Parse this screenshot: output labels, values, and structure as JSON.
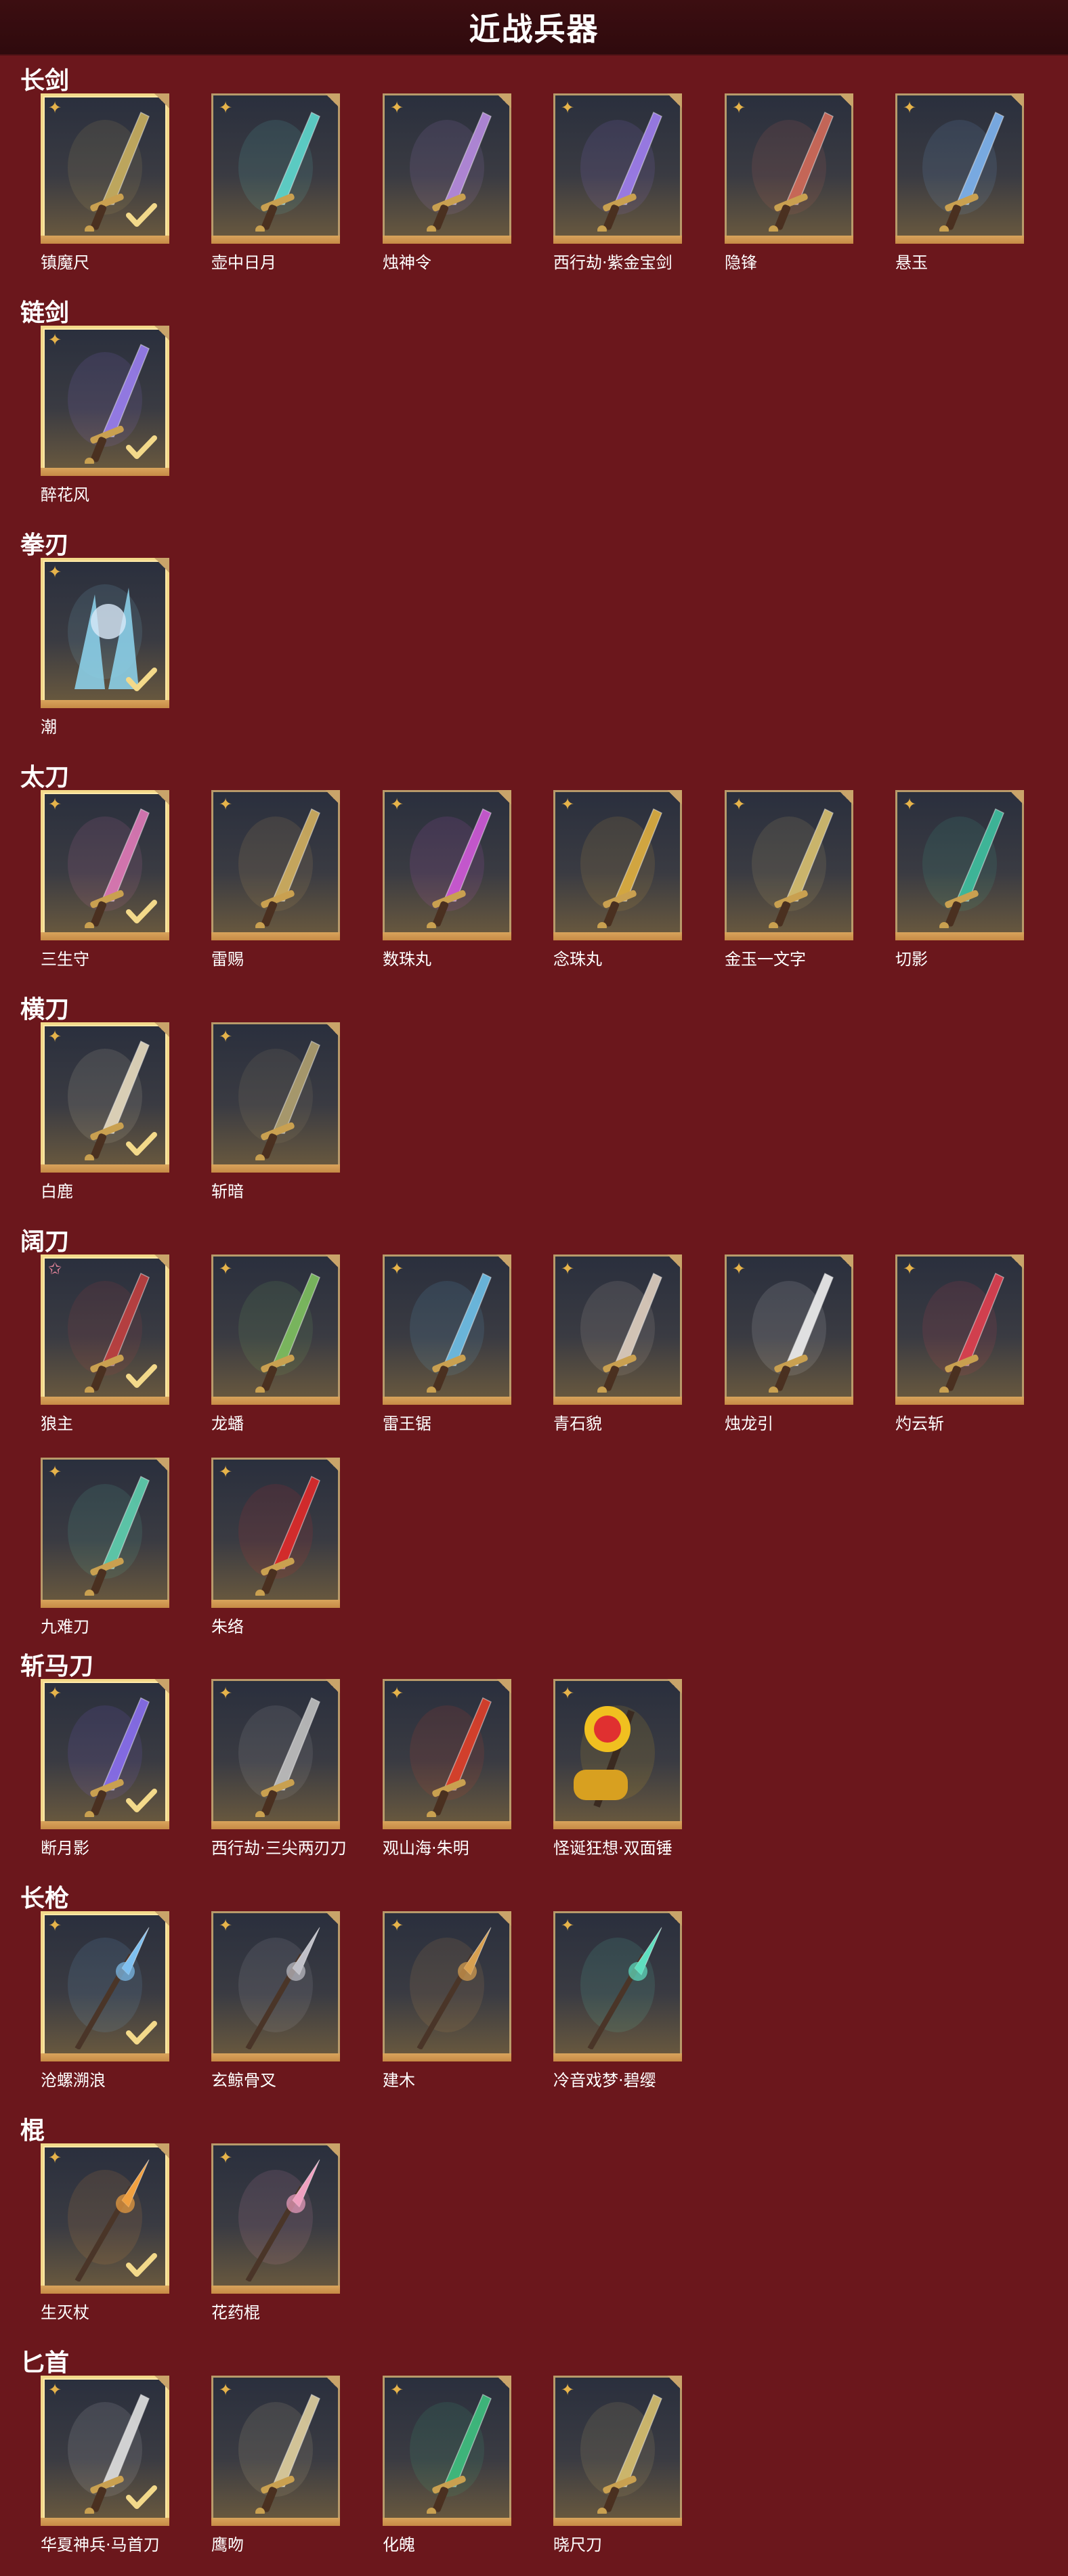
{
  "header": {
    "title": "近战兵器"
  },
  "colors": {
    "background": "#6b171c",
    "header_bg": "#2f0a0d",
    "frame_gold": "#b89a6a",
    "selected_gold": "#f3d98a",
    "star_gold": "#e6b34a",
    "star_pink": "#f08aa0"
  },
  "categories": [
    {
      "label": "长剑",
      "items": [
        {
          "name": "镇魔尺",
          "selected": true,
          "star": "gold",
          "icon": "sword-icon",
          "accent": "#c9b060"
        },
        {
          "name": "壶中日月",
          "selected": false,
          "star": "gold",
          "icon": "sword-icon",
          "accent": "#5fd8cf"
        },
        {
          "name": "烛神令",
          "selected": false,
          "star": "gold",
          "icon": "sword-icon",
          "accent": "#b88ce0"
        },
        {
          "name": "西行劫·紫金宝剑",
          "selected": false,
          "star": "gold",
          "icon": "sword-icon",
          "accent": "#a07ff0"
        },
        {
          "name": "隐锋",
          "selected": false,
          "star": "gold",
          "icon": "sword-icon",
          "accent": "#d26b5a"
        },
        {
          "name": "悬玉",
          "selected": false,
          "star": "gold",
          "icon": "sword-icon",
          "accent": "#7fb4f0"
        }
      ]
    },
    {
      "label": "链剑",
      "items": [
        {
          "name": "醉花风",
          "selected": true,
          "star": "gold",
          "icon": "chain-sword-icon",
          "accent": "#9a7ff0"
        }
      ]
    },
    {
      "label": "拳刃",
      "items": [
        {
          "name": "潮",
          "selected": true,
          "star": "gold",
          "icon": "fist-blade-icon",
          "accent": "#8ed6f0"
        }
      ]
    },
    {
      "label": "太刀",
      "items": [
        {
          "name": "三生守",
          "selected": true,
          "star": "gold",
          "icon": "katana-icon",
          "accent": "#e07ab8"
        },
        {
          "name": "雷赐",
          "selected": false,
          "star": "gold",
          "icon": "katana-icon",
          "accent": "#d2b060"
        },
        {
          "name": "数珠丸",
          "selected": false,
          "star": "gold",
          "icon": "katana-icon",
          "accent": "#d05ad8"
        },
        {
          "name": "念珠丸",
          "selected": false,
          "star": "gold",
          "icon": "katana-icon",
          "accent": "#e0b040"
        },
        {
          "name": "金玉一文字",
          "selected": false,
          "star": "gold",
          "icon": "katana-icon",
          "accent": "#d8c070"
        },
        {
          "name": "切影",
          "selected": false,
          "star": "gold",
          "icon": "katana-icon",
          "accent": "#3fc0a0"
        }
      ]
    },
    {
      "label": "横刀",
      "items": [
        {
          "name": "白鹿",
          "selected": true,
          "star": "gold",
          "icon": "dao-icon",
          "accent": "#e8dcc0"
        },
        {
          "name": "斩暗",
          "selected": false,
          "star": "gold",
          "icon": "dao-icon",
          "accent": "#b0a070"
        }
      ]
    },
    {
      "label": "阔刀",
      "items": [
        {
          "name": "狼主",
          "selected": true,
          "star": "pink",
          "icon": "broadsword-icon",
          "accent": "#c04040"
        },
        {
          "name": "龙蟠",
          "selected": false,
          "star": "gold",
          "icon": "broadsword-icon",
          "accent": "#7fc060"
        },
        {
          "name": "雷王锯",
          "selected": false,
          "star": "gold",
          "icon": "broadsword-icon",
          "accent": "#6fc0e8"
        },
        {
          "name": "青石貌",
          "selected": false,
          "star": "gold",
          "icon": "broadsword-icon",
          "accent": "#e0d0c0"
        },
        {
          "name": "烛龙引",
          "selected": false,
          "star": "gold",
          "icon": "broadsword-icon",
          "accent": "#f0f0f0"
        },
        {
          "name": "灼云斩",
          "selected": false,
          "star": "gold",
          "icon": "broadsword-icon",
          "accent": "#e04050"
        },
        {
          "name": "九难刀",
          "selected": false,
          "star": "gold",
          "icon": "broadsword-icon",
          "accent": "#5fd0b0"
        },
        {
          "name": "朱络",
          "selected": false,
          "star": "gold",
          "icon": "broadsword-icon",
          "accent": "#e02a2a"
        }
      ]
    },
    {
      "label": "斩马刀",
      "items": [
        {
          "name": "断月影",
          "selected": true,
          "star": "gold",
          "icon": "zhanmadao-icon",
          "accent": "#8a6ff0"
        },
        {
          "name": "西行劫·三尖两刃刀",
          "selected": false,
          "star": "gold",
          "icon": "zhanmadao-icon",
          "accent": "#c0c0c0"
        },
        {
          "name": "观山海·朱明",
          "selected": false,
          "star": "gold",
          "icon": "zhanmadao-icon",
          "accent": "#e0402a"
        },
        {
          "name": "怪诞狂想·双面锤",
          "selected": false,
          "star": "gold",
          "icon": "hammer-icon",
          "accent": "#f0c020"
        }
      ]
    },
    {
      "label": "长枪",
      "items": [
        {
          "name": "沧螺溯浪",
          "selected": true,
          "star": "gold",
          "icon": "spear-icon",
          "accent": "#7fc0f0"
        },
        {
          "name": "玄鲸骨叉",
          "selected": false,
          "star": "gold",
          "icon": "spear-icon",
          "accent": "#c0c0c8"
        },
        {
          "name": "建木",
          "selected": false,
          "star": "gold",
          "icon": "spear-icon",
          "accent": "#d8a050"
        },
        {
          "name": "冷音戏梦·碧缨",
          "selected": false,
          "star": "gold",
          "icon": "spear-icon",
          "accent": "#5fe0c0"
        }
      ]
    },
    {
      "label": "棍",
      "items": [
        {
          "name": "生灭杖",
          "selected": true,
          "star": "gold",
          "icon": "staff-icon",
          "accent": "#f0a040"
        },
        {
          "name": "花药棍",
          "selected": false,
          "star": "gold",
          "icon": "staff-icon",
          "accent": "#f0a0c0"
        }
      ]
    },
    {
      "label": "匕首",
      "items": [
        {
          "name": "华夏神兵·马首刀",
          "selected": true,
          "star": "gold",
          "icon": "dagger-icon",
          "accent": "#e0e0e0"
        },
        {
          "name": "鹰吻",
          "selected": false,
          "star": "gold",
          "icon": "dagger-icon",
          "accent": "#e0d0a0"
        },
        {
          "name": "化魄",
          "selected": false,
          "star": "gold",
          "icon": "dagger-icon",
          "accent": "#3fc080"
        },
        {
          "name": "晓尺刀",
          "selected": false,
          "star": "gold",
          "icon": "dagger-icon",
          "accent": "#d8c070"
        }
      ]
    }
  ]
}
